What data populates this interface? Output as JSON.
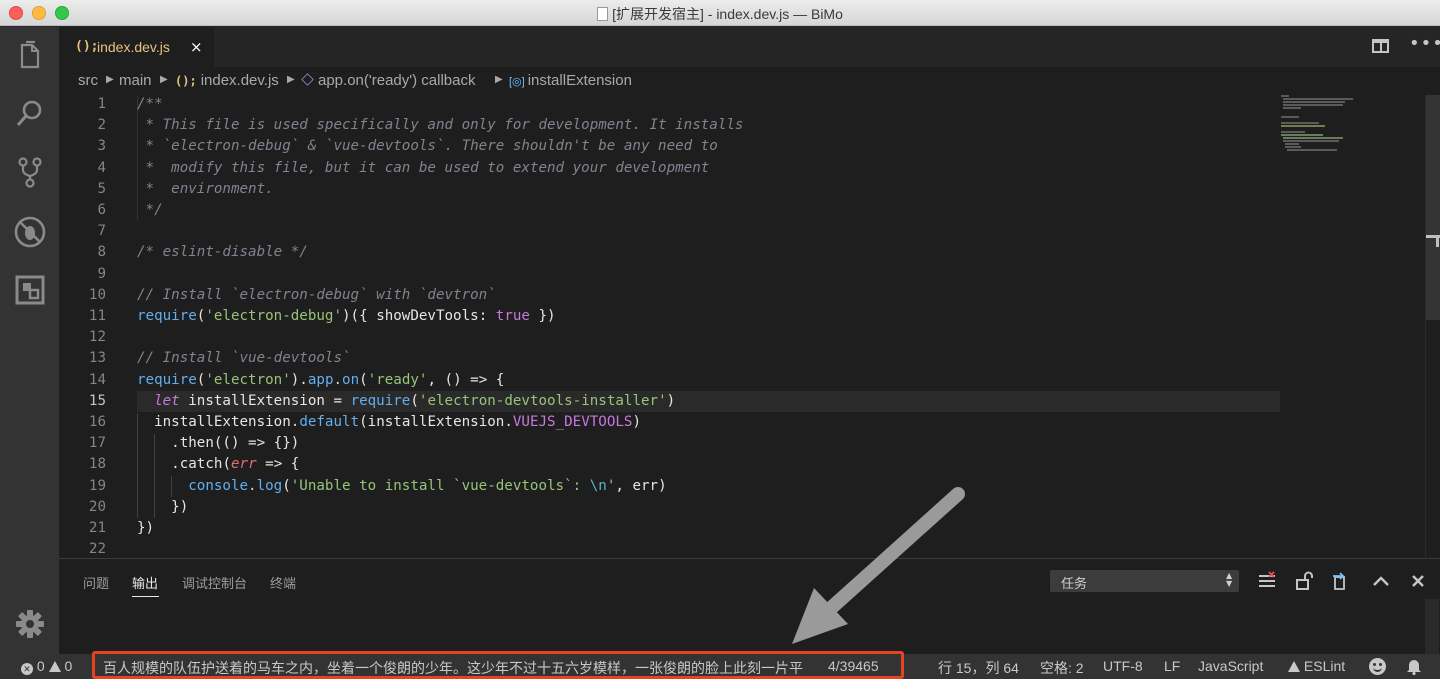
{
  "window": {
    "title": "[扩展开发宿主] - index.dev.js — BiMo"
  },
  "activity_bar": {
    "items": [
      "explorer-icon",
      "search-icon",
      "source-control-icon",
      "debug-icon",
      "extensions-icon"
    ],
    "manage": "gear-icon"
  },
  "tab": {
    "label": "index.dev.js",
    "lang_badge": "();",
    "close": "×"
  },
  "breadcrumbs": {
    "items": [
      "src",
      "main",
      "index.dev.js",
      "app.on('ready') callback",
      "installExtension"
    ],
    "js_badge": "();",
    "var_badge": "[◎]"
  },
  "editor": {
    "line_numbers": [
      "1",
      "2",
      "3",
      "4",
      "5",
      "6",
      "7",
      "8",
      "9",
      "10",
      "11",
      "12",
      "13",
      "14",
      "15",
      "16",
      "17",
      "18",
      "19",
      "20",
      "21",
      "22"
    ],
    "active_line": "15",
    "lines": [
      "/**",
      " * This file is used specifically and only for development. It installs",
      " * `electron-debug` & `vue-devtools`. There shouldn't be any need to",
      " *  modify this file, but it can be used to extend your development",
      " *  environment.",
      " */",
      "",
      "/* eslint-disable */",
      "",
      "// Install `electron-debug` with `devtron`",
      "require('electron-debug')({ showDevTools: true })",
      "",
      "// Install `vue-devtools`",
      "require('electron').app.on('ready', () => {",
      "  let installExtension = require('electron-devtools-installer')",
      "  installExtension.default(installExtension.VUEJS_DEVTOOLS)",
      "    .then(() => {})",
      "    .catch(err => {",
      "      console.log('Unable to install `vue-devtools`: \\n', err)",
      "    })",
      "})",
      ""
    ]
  },
  "panel": {
    "tabs": [
      "问题",
      "输出",
      "调试控制台",
      "终端"
    ],
    "active_tab": "输出",
    "task_select": "任务",
    "actions": [
      "clear-output-icon",
      "lock-scroll-icon",
      "open-in-editor-icon",
      "maximize-panel-icon",
      "close-panel-icon"
    ]
  },
  "status_bar": {
    "errors": "0",
    "warnings": "0",
    "message": "百人规模的队伍护送着的马车之内，坐着一个俊朗的少年。这少年不过十五六岁模样，一张俊朗的脸上此刻一片平",
    "progress": "4/39465",
    "position": "行 15，列 64",
    "spaces": "空格: 2",
    "encoding": "UTF-8",
    "eol": "LF",
    "language": "JavaScript",
    "eslint": "ESLint"
  },
  "colors": {
    "accent_tab": "#e6c37c",
    "highlight_box": "#e8431f",
    "status_bar_bg": "#333333"
  }
}
